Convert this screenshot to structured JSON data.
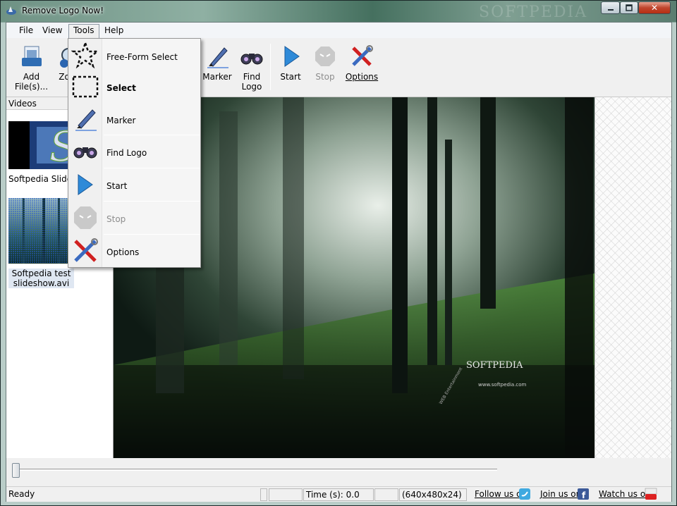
{
  "window": {
    "title": "Remove Logo Now!",
    "watermark": "SOFTPEDIA"
  },
  "menubar": {
    "items": [
      {
        "label": "File"
      },
      {
        "label": "View"
      },
      {
        "label": "Tools"
      },
      {
        "label": "Help"
      }
    ]
  },
  "toolbar": {
    "add_files": "Add\nFile(s)...",
    "zoom_partial": "Zo",
    "marker": "Marker",
    "find_logo": "Find\nLogo",
    "start": "Start",
    "stop": "Stop",
    "options": "Options"
  },
  "tools_menu": {
    "items": [
      {
        "label": "Free-Form Select",
        "icon": "free-form-select-icon"
      },
      {
        "label": "Select",
        "icon": "rect-select-icon"
      },
      {
        "label": "Marker",
        "icon": "marker-icon"
      },
      {
        "label": "Find Logo",
        "icon": "binoculars-icon"
      },
      {
        "label": "Start",
        "icon": "play-icon"
      },
      {
        "label": "Stop",
        "icon": "stop-icon"
      },
      {
        "label": "Options",
        "icon": "tools-icon"
      }
    ]
  },
  "videos": {
    "header": "Videos",
    "items": [
      {
        "caption": "Softpedia Slidesh"
      },
      {
        "caption": "Softpedia test\nslideshow.avi"
      }
    ]
  },
  "preview": {
    "overlay_brand": "SOFTPEDIA",
    "overlay_url": "www.softpedia.com",
    "overlay_side": "WEB Entertainment"
  },
  "statusbar": {
    "status": "Ready",
    "time": "Time (s): 0.0",
    "resolution": "(640x480x24)",
    "follow": "Follow us on",
    "join": "Join us on",
    "watch": "Watch us on"
  },
  "slider": {
    "position": 0
  }
}
